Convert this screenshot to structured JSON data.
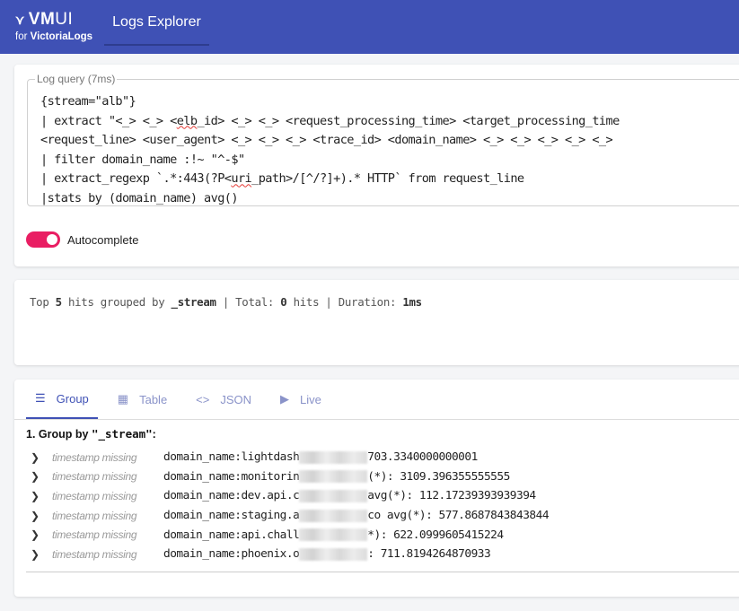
{
  "header": {
    "logo_main": "VM",
    "logo_ui": "UI",
    "logo_sub_prefix": "for ",
    "logo_sub_brand": "VictoriaLogs",
    "nav_tab": "Logs Explorer",
    "color": "#3f51b5"
  },
  "query": {
    "legend": "Log query (7ms)",
    "lines": [
      "{stream=\"alb\"}",
      "| extract \"<_> <_> <",
      "elb",
      "_id> <_> <_> <request_processing_time> <target_processing_time",
      "<request_line> <user_agent> <_> <_> <_> <trace_id> <domain_name> <_> <_> <_> <_> <_>",
      "| filter domain_name :!~ \"^-$\"",
      "| extract_regexp `.*:443(?P<",
      "uri",
      "_path>/[^/?]+).* HTTP` from request_line",
      "|stats by (domain_name) avg()"
    ]
  },
  "autocomplete": {
    "label": "Autocomplete",
    "enabled": true,
    "color": "#e91e63"
  },
  "stats": {
    "prefix": "Top ",
    "top": "5",
    "mid": " hits grouped by ",
    "field": "_stream",
    "sep1": " | Total: ",
    "total": "0",
    "sep2": " hits | Duration: ",
    "duration": "1ms"
  },
  "tabs": [
    {
      "label": "Group",
      "icon": "list-icon"
    },
    {
      "label": "Table",
      "icon": "table-icon"
    },
    {
      "label": "JSON",
      "icon": "code-icon"
    },
    {
      "label": "Live",
      "icon": "play-icon"
    }
  ],
  "group": {
    "title_prefix": "1. Group by ",
    "title_field": "\"_stream\"",
    "title_suffix": ":"
  },
  "rows": [
    {
      "ts": "timestamp missing",
      "key": "domain_name: ",
      "prefix": "lightdash",
      "suffix": "703.3340000000001"
    },
    {
      "ts": "timestamp missing",
      "key": "domain_name: ",
      "prefix": "monitorin",
      "suffix": "(*): 3109.396355555555"
    },
    {
      "ts": "timestamp missing",
      "key": "domain_name: ",
      "prefix": "dev.api.c",
      "suffix": "avg(*): 112.17239393939394"
    },
    {
      "ts": "timestamp missing",
      "key": "domain_name: ",
      "prefix": "staging.a",
      "suffix": "co  avg(*): 577.8687843843844"
    },
    {
      "ts": "timestamp missing",
      "key": "domain_name: ",
      "prefix": "api.chall",
      "suffix": "*): 622.0999605415224"
    },
    {
      "ts": "timestamp missing",
      "key": "domain_name: ",
      "prefix": "phoenix.o",
      "suffix": ": 711.8194264870933"
    }
  ]
}
